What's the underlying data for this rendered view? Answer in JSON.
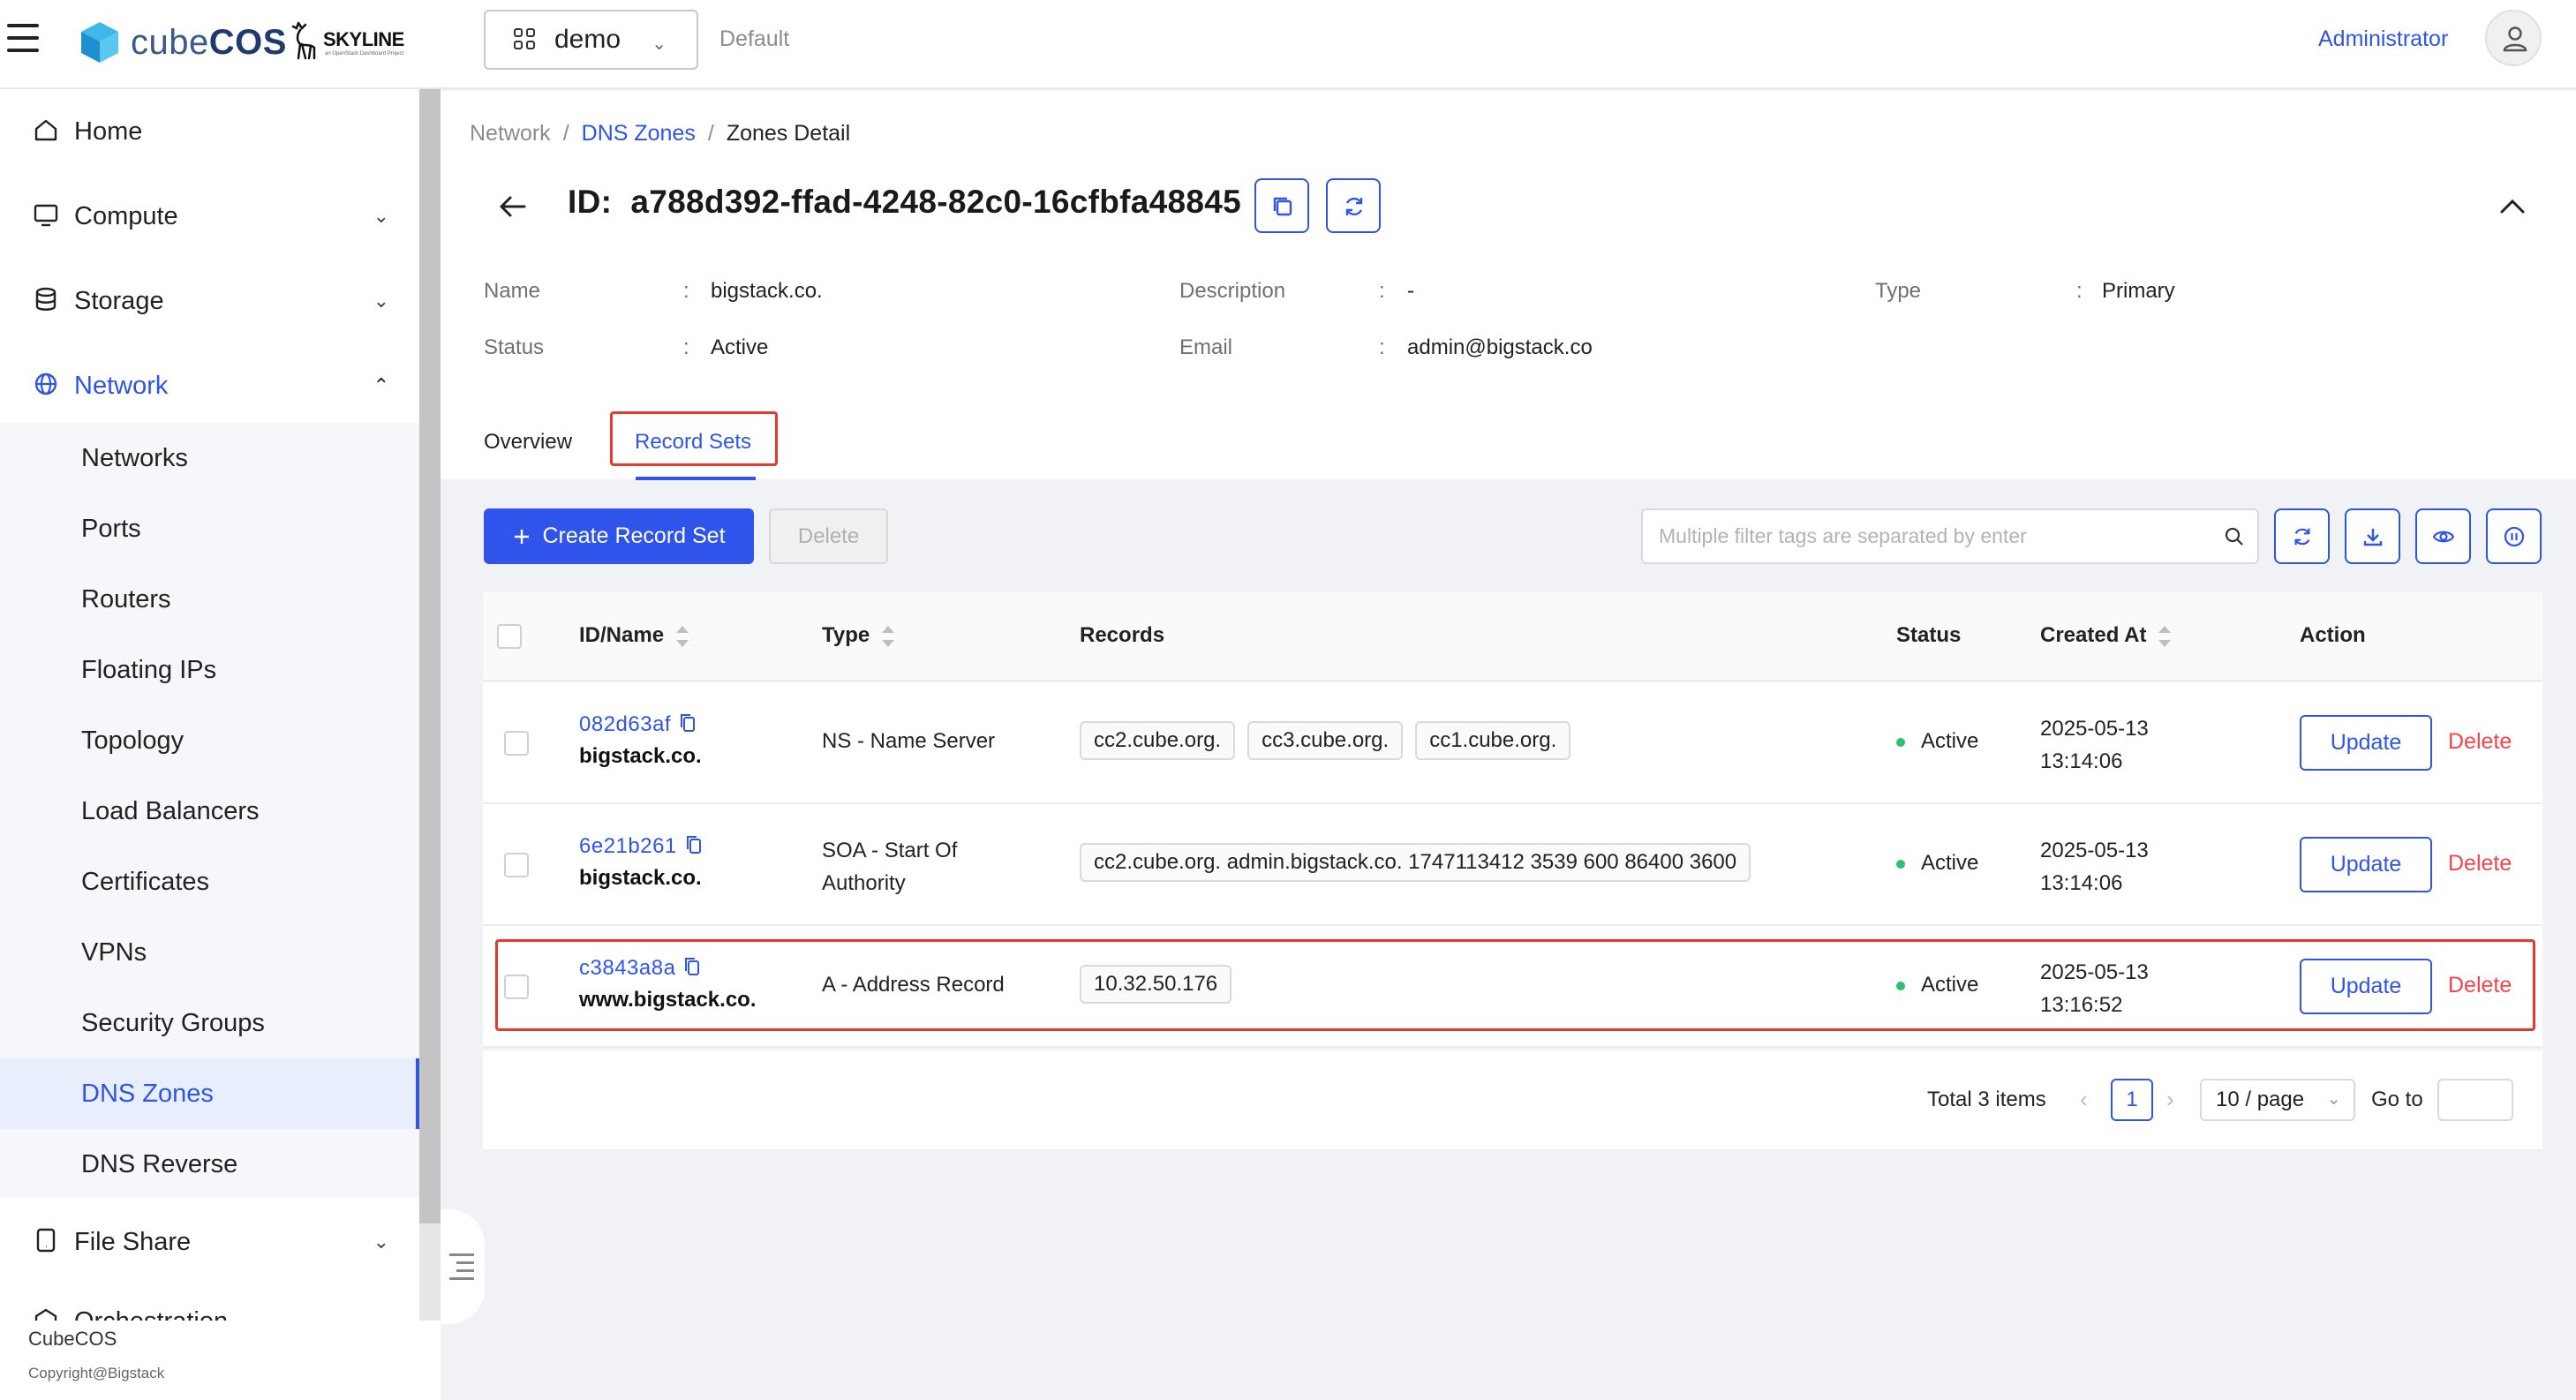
{
  "header": {
    "logo_text_light": "cube",
    "logo_text_bold": "COS",
    "skyline_text": "SKYLINE",
    "skyline_sub": "an OpenStack Dashboard Project",
    "project": "demo",
    "domain": "Default",
    "user": "Administrator"
  },
  "sidebar": {
    "top_items": [
      {
        "label": "Home",
        "icon": "home-icon"
      },
      {
        "label": "Compute",
        "icon": "monitor-icon"
      },
      {
        "label": "Storage",
        "icon": "database-icon"
      },
      {
        "label": "Network",
        "icon": "globe-icon"
      },
      {
        "label": "File Share",
        "icon": "file-share-icon"
      },
      {
        "label": "Orchestration",
        "icon": "orchestration-icon"
      }
    ],
    "network_items": [
      "Networks",
      "Ports",
      "Routers",
      "Floating IPs",
      "Topology",
      "Load Balancers",
      "Certificates",
      "VPNs",
      "Security Groups",
      "DNS Zones",
      "DNS Reverse"
    ],
    "active_item": "DNS Zones",
    "footer_title": "CubeCOS",
    "footer_copyright": "Copyright@Bigstack"
  },
  "breadcrumb": {
    "root": "Network",
    "parent": "DNS Zones",
    "current": "Zones Detail",
    "separator": "/"
  },
  "detail": {
    "id_label": "ID:",
    "id": "a788d392-ffad-4248-82c0-16cfbfa48845",
    "colon": ":",
    "fields": {
      "name_label": "Name",
      "name_value": "bigstack.co.",
      "description_label": "Description",
      "description_value": "-",
      "type_label": "Type",
      "type_value": "Primary",
      "status_label": "Status",
      "status_value": "Active",
      "email_label": "Email",
      "email_value": "admin@bigstack.co"
    }
  },
  "tabs": {
    "overview": "Overview",
    "record_sets": "Record Sets",
    "active": "Record Sets"
  },
  "toolbar": {
    "create_label": "Create Record Set",
    "create_icon": "plus-icon",
    "delete_label": "Delete",
    "search_placeholder": "Multiple filter tags are separated by enter"
  },
  "table": {
    "columns": [
      "ID/Name",
      "Type",
      "Records",
      "Status",
      "Created At",
      "Action"
    ],
    "rows": [
      {
        "id": "082d63af",
        "name": "bigstack.co.",
        "type": "NS - Name Server",
        "records": [
          "cc2.cube.org.",
          "cc3.cube.org.",
          "cc1.cube.org."
        ],
        "status": "Active",
        "created_date": "2025-05-13",
        "created_time": "13:14:06",
        "update_label": "Update",
        "delete_label": "Delete"
      },
      {
        "id": "6e21b261",
        "name": "bigstack.co.",
        "type_line1": "SOA - Start Of",
        "type_line2": "Authority",
        "records": [
          "cc2.cube.org. admin.bigstack.co. 1747113412 3539 600 86400 3600"
        ],
        "status": "Active",
        "created_date": "2025-05-13",
        "created_time": "13:14:06",
        "update_label": "Update",
        "delete_label": "Delete"
      },
      {
        "id": "c3843a8a",
        "name": "www.bigstack.co.",
        "type": "A - Address Record",
        "records": [
          "10.32.50.176"
        ],
        "status": "Active",
        "created_date": "2025-05-13",
        "created_time": "13:16:52",
        "update_label": "Update",
        "delete_label": "Delete"
      }
    ]
  },
  "pagination": {
    "total": "Total 3 items",
    "current_page": "1",
    "page_size": "10 / page",
    "goto_label": "Go to"
  },
  "colors": {
    "accent": "#2f54eb",
    "danger": "#f5454b",
    "highlight": "#e5392b",
    "status_active": "#2fbf71"
  }
}
